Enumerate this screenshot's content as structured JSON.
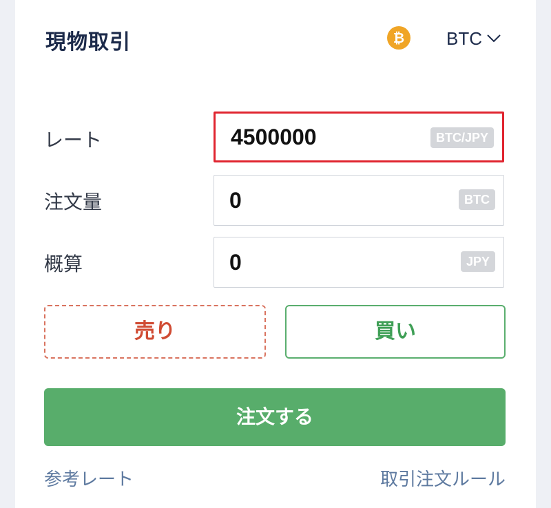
{
  "header": {
    "title": "現物取引",
    "coin_icon": "bitcoin-icon",
    "coin_glyph": "₿",
    "currency": "BTC",
    "accent_color": "#f0a526"
  },
  "form": {
    "rate": {
      "label": "レート",
      "value": "4500000",
      "unit": "BTC/JPY"
    },
    "amount": {
      "label": "注文量",
      "value": "0",
      "unit": "BTC"
    },
    "estimate": {
      "label": "概算",
      "value": "0",
      "unit": "JPY"
    }
  },
  "actions": {
    "sell_label": "売り",
    "buy_label": "買い",
    "order_label": "注文する",
    "sell_color": "#d04b33",
    "buy_color": "#3f9f56",
    "order_color": "#58ad6b"
  },
  "links": {
    "reference_rate": "参考レート",
    "trading_rules": "取引注文ルール"
  }
}
